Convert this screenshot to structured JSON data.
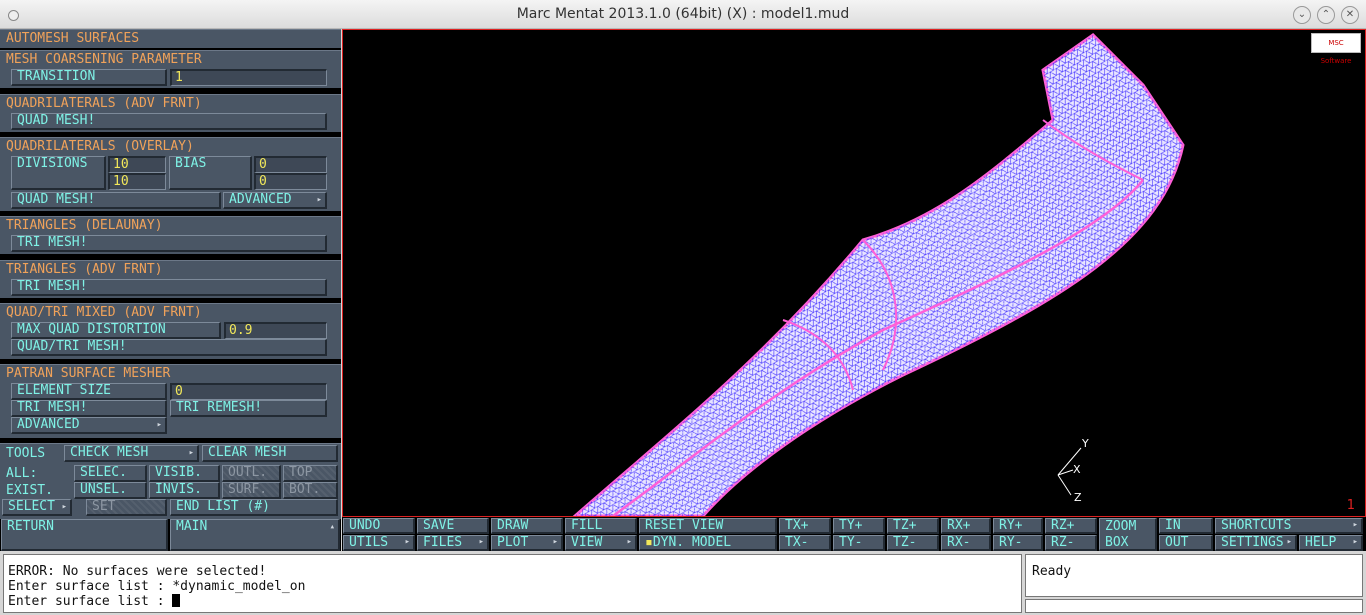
{
  "window": {
    "title": "Marc Mentat 2013.1.0 (64bit) (X) : model1.mud"
  },
  "titlebar_buttons": [
    "⌄",
    "⌃",
    "✕"
  ],
  "panel": {
    "title": "AUTOMESH SURFACES",
    "coarsening": {
      "header": "MESH COARSENING PARAMETER",
      "transition_label": "TRANSITION",
      "transition_value": "1"
    },
    "quad_adv": {
      "header": "QUADRILATERALS (ADV FRNT)",
      "mesh_label": "QUAD MESH!"
    },
    "quad_overlay": {
      "header": "QUADRILATERALS (OVERLAY)",
      "divisions_label": "DIVISIONS",
      "div1": "10",
      "div2": "10",
      "bias_label": "BIAS",
      "bias1": "0",
      "bias2": "0",
      "mesh_label": "QUAD MESH!",
      "advanced_label": "ADVANCED"
    },
    "tri_delaunay": {
      "header": "TRIANGLES (DELAUNAY)",
      "mesh_label": "TRI MESH!"
    },
    "tri_adv": {
      "header": "TRIANGLES (ADV FRNT)",
      "mesh_label": "TRI MESH!"
    },
    "quadtri": {
      "header": "QUAD/TRI MIXED (ADV FRNT)",
      "distortion_label": "MAX QUAD DISTORTION",
      "distortion_value": "0.9",
      "mesh_label": "QUAD/TRI MESH!"
    },
    "patran": {
      "header": "PATRAN SURFACE MESHER",
      "element_size_label": "ELEMENT SIZE",
      "element_size_value": "0",
      "tri_mesh_label": "TRI MESH!",
      "tri_remesh_label": "TRI REMESH!",
      "advanced_label": "ADVANCED"
    },
    "tools": {
      "label": "TOOLS",
      "check_mesh": "CHECK MESH",
      "clear_mesh": "CLEAR MESH",
      "all": "ALL:",
      "exist": "EXIST.",
      "select": "SELECT",
      "selec": "SELEC.",
      "unsel": "UNSEL.",
      "set": "SET",
      "visib": "VISIB.",
      "invis": "INVIS.",
      "end_list": "END LIST (#)",
      "outl": "OUTL.",
      "surf": "SURF.",
      "top": "TOP",
      "bot": "BOT."
    },
    "return_label": "RETURN",
    "main_label": "MAIN"
  },
  "viewport": {
    "logo": "MSC Software",
    "number": "1",
    "triad": {
      "y": "Y",
      "x": "X",
      "z": "Z"
    }
  },
  "toolbar": {
    "undo": "UNDO",
    "utils": "UTILS",
    "save": "SAVE",
    "files": "FILES",
    "draw": "DRAW",
    "plot": "PLOT",
    "fill": "FILL",
    "view": "VIEW",
    "reset_view": "RESET VIEW",
    "dyn_model": "DYN. MODEL",
    "txp": "TX+",
    "txm": "TX-",
    "typ": "TY+",
    "tym": "TY-",
    "tzp": "TZ+",
    "tzm": "TZ-",
    "rxp": "RX+",
    "rxm": "RX-",
    "ryp": "RY+",
    "rym": "RY-",
    "rzp": "RZ+",
    "rzm": "RZ-",
    "zoom": "ZOOM",
    "box": "BOX",
    "in": "IN",
    "out": "OUT",
    "shortcuts": "SHORTCUTS",
    "settings": "SETTINGS",
    "help": "HELP"
  },
  "console": {
    "line1": "ERROR: No surfaces were selected!",
    "line2": "Enter surface list : *dynamic_model_on",
    "line3": "Enter surface list : ",
    "status": "Ready"
  },
  "colors": {
    "header": "#f0a25a",
    "button_text": "#7ff2e6",
    "value_text": "#f2e85a",
    "panel": "#4a5665",
    "mesh": "#ff5fd8",
    "mesh_lines": "#3a28ff"
  }
}
